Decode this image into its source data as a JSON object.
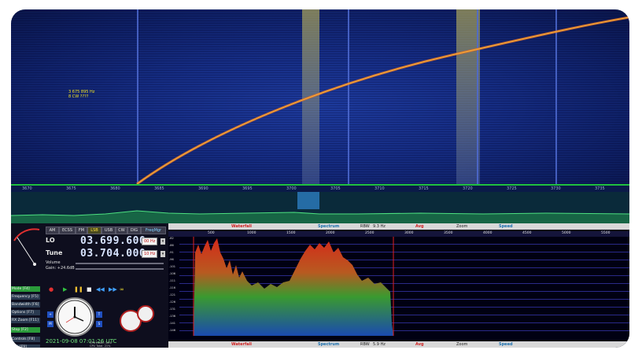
{
  "waterfall": {
    "marker_freq": "3 675 895 Hz",
    "marker_sub": "8 CW ????",
    "scale_ticks": [
      "3670",
      "3675",
      "3680",
      "3685",
      "3690",
      "3695",
      "3700",
      "3705",
      "3710",
      "3715",
      "3720",
      "3725",
      "3730",
      "3735"
    ]
  },
  "radio": {
    "modes": [
      "AM",
      "ECSS",
      "FM",
      "LSB",
      "USB",
      "CW",
      "DIG",
      "FreqMgr"
    ],
    "active_mode": "LSB",
    "lo_label": "LO",
    "lo_freq": "03.699.600",
    "lo_step": "00 Hz",
    "tune_label": "Tune",
    "tune_freq": "03.704.000",
    "tune_step": "10 Hz",
    "volume_label": "Volume",
    "gain_label": "Gain: +24.6dB",
    "side_buttons": [
      "Mode  [F4]",
      "Frequency  [F5]",
      "Bandwidth  [F6]",
      "Options  [F7]",
      "RX Zoom  [F11]",
      "Stop  [F2]",
      "Controls  [F8]",
      "Exit  [F9]"
    ],
    "datetime": "2021-09-08  07:01:26 UTC",
    "cpu": [
      "CPU ExtIO: 14%",
      "CPU Total: 21%"
    ]
  },
  "spectrum": {
    "top_bar": {
      "waterfall": "Waterfall",
      "spectrum": "Spectrum",
      "rbw_label": "RBW",
      "rbw_value": "9.3 Hz",
      "avg": "Avg",
      "zoom": "Zoom",
      "speed": "Speed"
    },
    "bottom_bar": {
      "waterfall": "Waterfall",
      "spectrum": "Spectrum",
      "rbw_label": "RBW",
      "rbw_value": "5.9 Hz",
      "avg": "Avg",
      "zoom": "Zoom",
      "speed": "Speed"
    },
    "ticks": [
      "500",
      "1000",
      "1500",
      "2000",
      "2500",
      "3000",
      "3500",
      "4000",
      "4500",
      "5000",
      "5500"
    ],
    "db_ticks": [
      "-82",
      "-86",
      "-91",
      "-96",
      "-101",
      "-106",
      "-111",
      "-116",
      "-121",
      "-126",
      "-131",
      "-136",
      "-141",
      "-146"
    ]
  }
}
